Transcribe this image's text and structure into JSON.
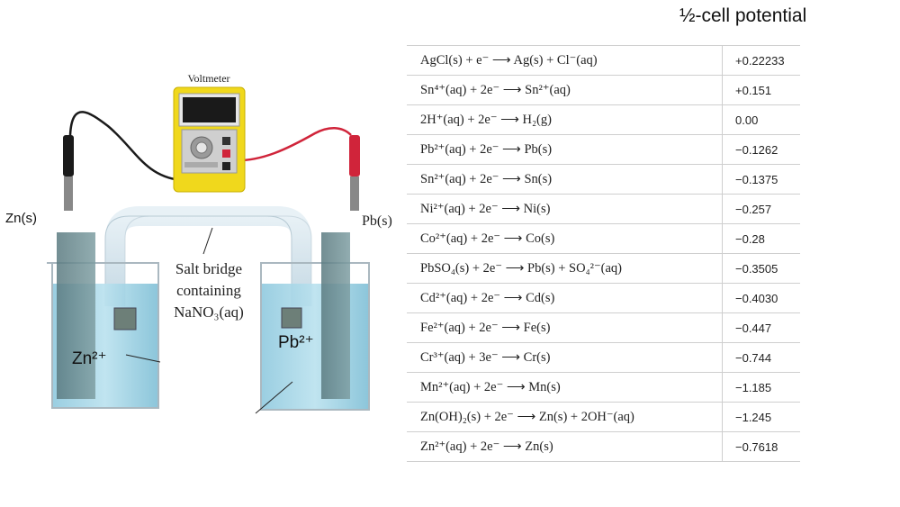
{
  "header": {
    "title": "½-cell potential"
  },
  "diagram": {
    "voltmeter_label": "Voltmeter",
    "left_electrode_label": "Zn(s)",
    "right_electrode_label": "Pb(s)",
    "salt_bridge_line1": "Salt bridge",
    "salt_bridge_line2": "containing",
    "salt_bridge_line3": "NaNO₃(aq)",
    "left_ion_label": "Zn²⁺",
    "right_ion_label": "Pb²⁺"
  },
  "table": {
    "rows": [
      {
        "reaction": "AgCl(s) + e⁻  ⟶  Ag(s) + Cl⁻(aq)",
        "potential": "+0.22233"
      },
      {
        "reaction": "Sn⁴⁺(aq) + 2e⁻  ⟶  Sn²⁺(aq)",
        "potential": "+0.151"
      },
      {
        "reaction": "2H⁺(aq) + 2e⁻  ⟶  H₂(g)",
        "potential": "0.00"
      },
      {
        "reaction": "Pb²⁺(aq) + 2e⁻  ⟶  Pb(s)",
        "potential": "−0.1262"
      },
      {
        "reaction": "Sn²⁺(aq) + 2e⁻  ⟶  Sn(s)",
        "potential": "−0.1375"
      },
      {
        "reaction": "Ni²⁺(aq) + 2e⁻  ⟶  Ni(s)",
        "potential": "−0.257"
      },
      {
        "reaction": "Co²⁺(aq) + 2e⁻  ⟶  Co(s)",
        "potential": "−0.28"
      },
      {
        "reaction": "PbSO₄(s) + 2e⁻  ⟶  Pb(s) + SO₄²⁻(aq)",
        "potential": "−0.3505"
      },
      {
        "reaction": "Cd²⁺(aq) + 2e⁻  ⟶  Cd(s)",
        "potential": "−0.4030"
      },
      {
        "reaction": "Fe²⁺(aq) + 2e⁻  ⟶  Fe(s)",
        "potential": "−0.447"
      },
      {
        "reaction": "Cr³⁺(aq) + 3e⁻  ⟶  Cr(s)",
        "potential": "−0.744"
      },
      {
        "reaction": "Mn²⁺(aq) + 2e⁻  ⟶  Mn(s)",
        "potential": "−1.185"
      },
      {
        "reaction": "Zn(OH)₂(s) + 2e⁻  ⟶  Zn(s) + 2OH⁻(aq)",
        "potential": "−1.245"
      },
      {
        "reaction": "Zn²⁺(aq) + 2e⁻  ⟶  Zn(s)",
        "potential": "−0.7618"
      }
    ]
  }
}
